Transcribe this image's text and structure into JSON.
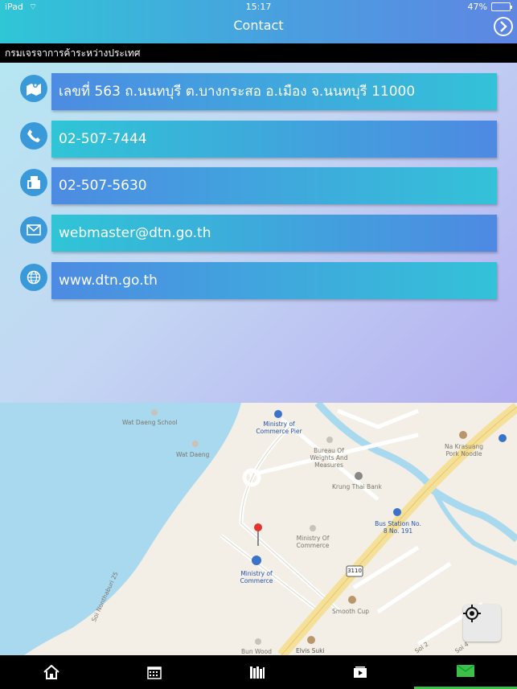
{
  "status": {
    "carrier": "iPad",
    "time": "15:17",
    "battery": "47%",
    "battery_level": 0.47
  },
  "header": {
    "title": "Contact"
  },
  "org_name": "กรมเจรจาการค้าระหว่างประเทศ",
  "contacts": [
    {
      "icon": "map-icon",
      "value": "เลขที่ 563 ถ.นนทบุรี ต.บางกระสอ อ.เมือง จ.นนทบุรี 11000"
    },
    {
      "icon": "phone-icon",
      "value": "02-507-7444"
    },
    {
      "icon": "fax-icon",
      "value": "02-507-5630"
    },
    {
      "icon": "mail-icon",
      "value": "webmaster@dtn.go.th"
    },
    {
      "icon": "globe-icon",
      "value": "www.dtn.go.th"
    }
  ],
  "map": {
    "labels": {
      "wat_daeng_school": "Wat Daeng School",
      "wat_daeng": "Wat Daeng",
      "ministry_pier": "Ministry of Commerce Pier",
      "bureau": "Bureau Of Weights And Measures",
      "krung_thai": "Krung Thai Bank",
      "na_krasuang": "Na Krasuang Pork Noodle",
      "bus_station": "Bus Station No. 8 No. 191",
      "ministry_of_commerce_poi": "Ministry Of Commerce",
      "ministry_of_commerce": "Ministry of Commerce",
      "route": "3110",
      "smooth_cup": "Smooth Cup",
      "soi_nonthaburi": "Soi Nonthaburi 25",
      "bun_wood": "Bun Wood",
      "elvis_suki": "Elvis Suki",
      "soi_2": "Soi 2",
      "soi_4": "Soi 4"
    }
  },
  "tabs": [
    {
      "icon": "home-icon"
    },
    {
      "icon": "calendar-icon"
    },
    {
      "icon": "library-icon"
    },
    {
      "icon": "video-icon"
    },
    {
      "icon": "envelope-icon",
      "active": true
    }
  ]
}
